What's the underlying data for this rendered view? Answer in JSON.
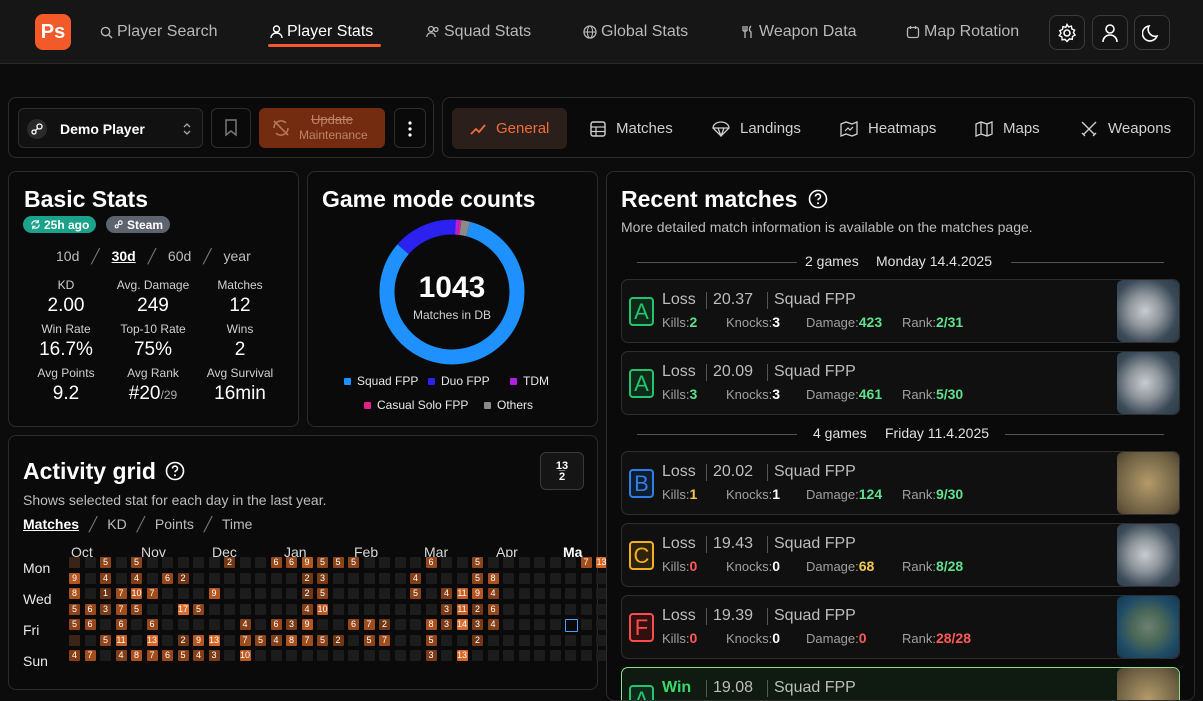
{
  "nav": {
    "logo": "Ps",
    "links": [
      "Player Search",
      "Player Stats",
      "Squad Stats",
      "Global Stats",
      "Weapon Data",
      "Map Rotation"
    ]
  },
  "player": {
    "name": "Demo Player",
    "update_label": "Update",
    "update_sub": "Maintenance"
  },
  "tabs": [
    "General",
    "Matches",
    "Landings",
    "Heatmaps",
    "Maps",
    "Weapons"
  ],
  "basic": {
    "title": "Basic Stats",
    "badge_time": "25h ago",
    "badge_platform": "Steam",
    "periods": [
      "10d",
      "30d",
      "60d",
      "year"
    ],
    "stats": [
      {
        "label": "KD",
        "value": "2.00"
      },
      {
        "label": "Avg. Damage",
        "value": "249"
      },
      {
        "label": "Matches",
        "value": "12"
      },
      {
        "label": "Win Rate",
        "value": "16.7%"
      },
      {
        "label": "Top-10 Rate",
        "value": "75%"
      },
      {
        "label": "Wins",
        "value": "2"
      },
      {
        "label": "Avg Points",
        "value": "9.2"
      },
      {
        "label": "Avg Rank",
        "value": "#20",
        "value_sub": "/29"
      },
      {
        "label": "Avg Survival",
        "value": "16min"
      }
    ]
  },
  "gamemodes": {
    "title": "Game mode counts",
    "total": "1043",
    "total_label": "Matches in DB",
    "legend": [
      {
        "name": "Squad FPP",
        "color": "#1e90ff"
      },
      {
        "name": "Duo FPP",
        "color": "#2b22f0"
      },
      {
        "name": "TDM",
        "color": "#b020e0"
      },
      {
        "name": "Casual Solo FPP",
        "color": "#e0208c"
      },
      {
        "name": "Others",
        "color": "#8a8a8a"
      }
    ],
    "chart_data": {
      "type": "pie",
      "categories": [
        "Squad FPP",
        "Duo FPP",
        "TDM",
        "Casual Solo FPP",
        "Others"
      ],
      "values": [
        860,
        150,
        8,
        5,
        20
      ]
    }
  },
  "activity": {
    "title": "Activity grid",
    "subtitle": "Shows selected stat for each day in the last year.",
    "options": [
      "Matches",
      "KD",
      "Points",
      "Time"
    ],
    "months": [
      "Oct",
      "Nov",
      "Dec",
      "Jan",
      "Feb",
      "Mar",
      "Apr",
      "Ma"
    ],
    "days": [
      "Mon",
      "Wed",
      "Fri",
      "Sun"
    ]
  },
  "recent": {
    "title": "Recent matches",
    "subtitle": "More detailed match information is available on the matches page.",
    "groups": [
      {
        "count": "2 games",
        "date": "Monday 14.4.2025"
      },
      {
        "count": "4 games",
        "date": "Friday 11.4.2025"
      }
    ],
    "matches": [
      {
        "grade": "A",
        "result": "Loss",
        "score": "20.37",
        "mode": "Squad FPP",
        "kills": "2",
        "knocks": "3",
        "damage": "423",
        "rank": "2/31"
      },
      {
        "grade": "A",
        "result": "Loss",
        "score": "20.09",
        "mode": "Squad FPP",
        "kills": "3",
        "knocks": "3",
        "damage": "461",
        "rank": "5/30"
      },
      {
        "grade": "B",
        "result": "Loss",
        "score": "20.02",
        "mode": "Squad FPP",
        "kills": "1",
        "knocks": "1",
        "damage": "124",
        "rank": "9/30"
      },
      {
        "grade": "C",
        "result": "Loss",
        "score": "19.43",
        "mode": "Squad FPP",
        "kills": "0",
        "knocks": "0",
        "damage": "68",
        "rank": "8/28"
      },
      {
        "grade": "F",
        "result": "Loss",
        "score": "19.39",
        "mode": "Squad FPP",
        "kills": "0",
        "knocks": "0",
        "damage": "0",
        "rank": "28/28"
      },
      {
        "grade": "A",
        "result": "Win",
        "score": "19.08",
        "mode": "Squad FPP"
      }
    ],
    "labels": {
      "kills": "Kills:",
      "knocks": "Knocks:",
      "damage": "Damage:",
      "rank": "Rank:"
    }
  }
}
